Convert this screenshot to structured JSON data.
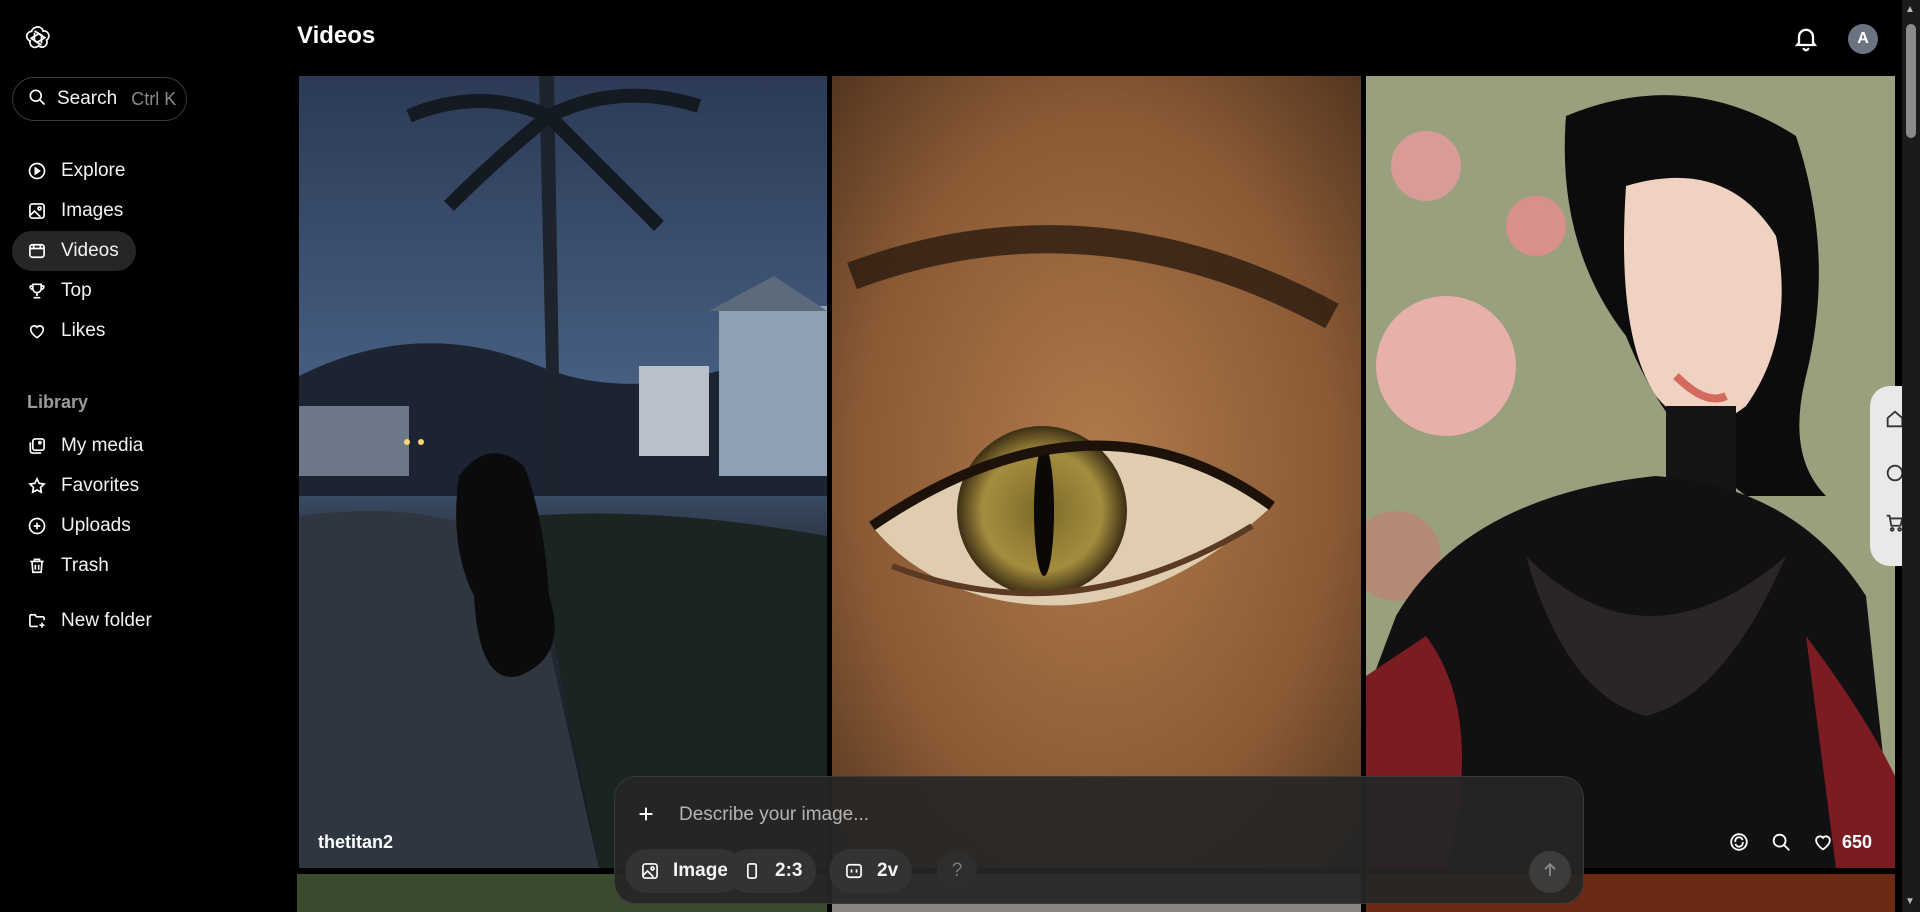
{
  "header": {
    "title": "Videos",
    "avatar_initial": "A"
  },
  "search": {
    "label": "Search",
    "shortcut": "Ctrl K"
  },
  "nav": {
    "explore": "Explore",
    "images": "Images",
    "videos": "Videos",
    "top": "Top",
    "likes": "Likes"
  },
  "library": {
    "heading": "Library",
    "my_media": "My media",
    "favorites": "Favorites",
    "uploads": "Uploads",
    "trash": "Trash",
    "new_folder": "New folder"
  },
  "gallery": {
    "tiles": [
      {
        "author": "thetitan2",
        "icon": "night-street-creature"
      },
      {
        "icon": "cat-eye-closeup"
      },
      {
        "icon": "woman-portrait-lace",
        "likes": "650"
      }
    ]
  },
  "composer": {
    "placeholder": "Describe your image...",
    "mode_label": "Image",
    "aspect_label": "2:3",
    "variations_label": "2v",
    "help_label": "?"
  },
  "colors": {
    "background": "#000000",
    "active_nav": "#262626",
    "composer": "#262626"
  }
}
